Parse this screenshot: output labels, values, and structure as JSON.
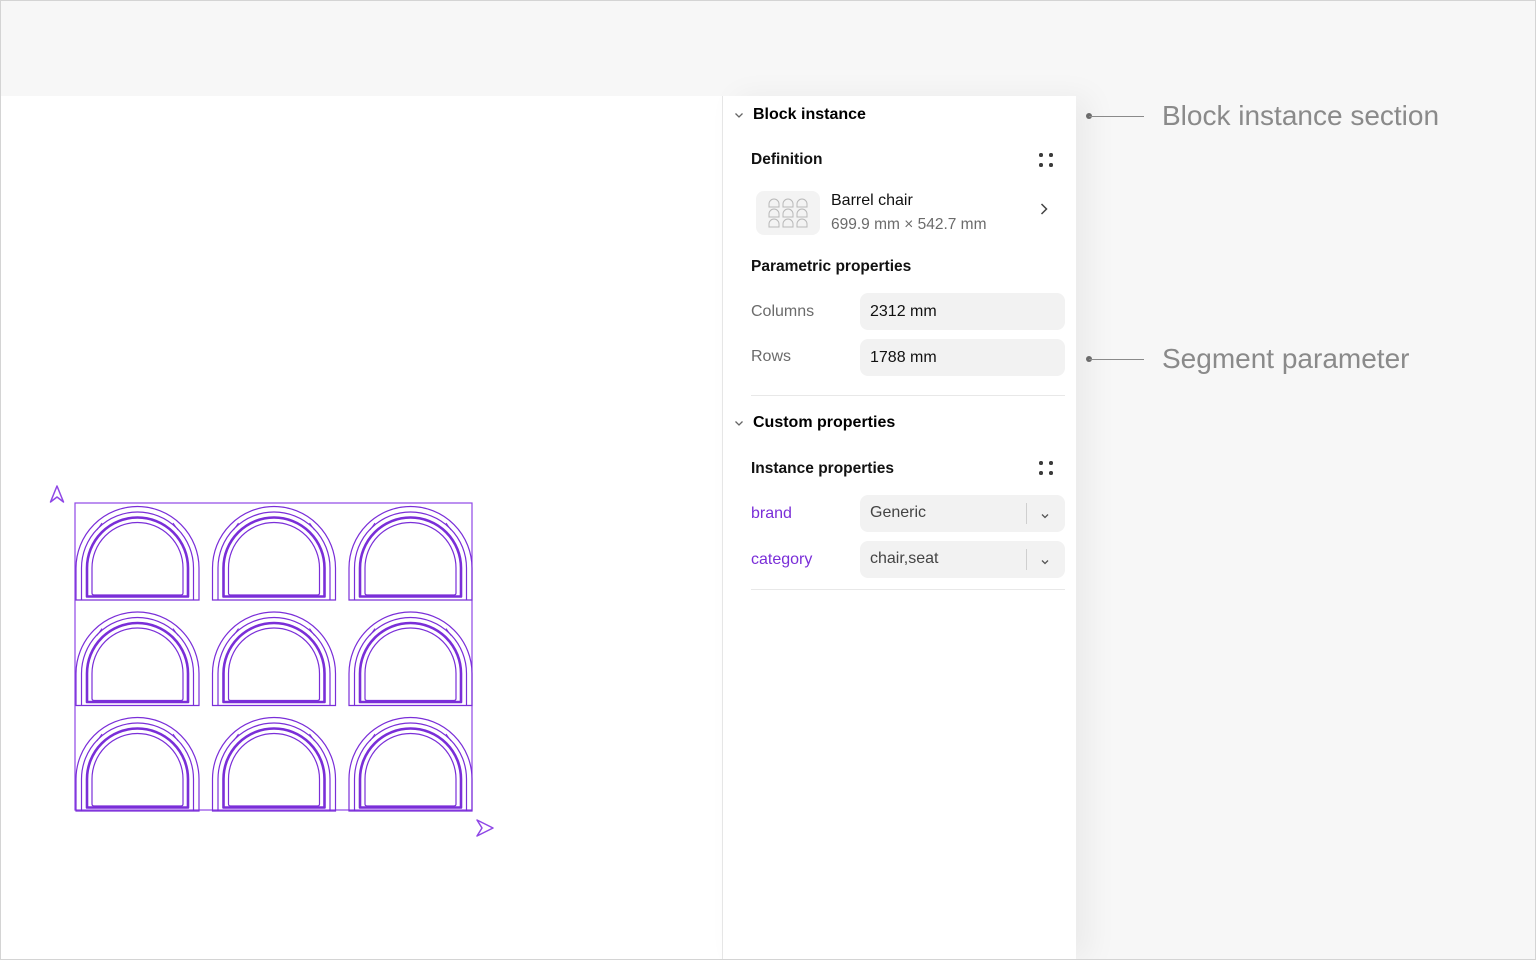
{
  "panel": {
    "block_instance": {
      "title": "Block instance",
      "definition_label": "Definition",
      "definition": {
        "name": "Barrel chair",
        "size": "699.9 mm × 542.7 mm"
      },
      "parametric_label": "Parametric properties",
      "params": [
        {
          "label": "Columns",
          "value": "2312 mm"
        },
        {
          "label": "Rows",
          "value": "1788 mm"
        }
      ]
    },
    "custom_properties": {
      "title": "Custom properties",
      "instance_label": "Instance properties",
      "props": [
        {
          "label": "brand",
          "value": "Generic"
        },
        {
          "label": "category",
          "value": "chair,seat"
        }
      ]
    }
  },
  "annotations": {
    "block_instance_section": "Block instance section",
    "segment_parameter": "Segment parameter"
  },
  "canvas": {
    "grid_columns": 3,
    "grid_rows": 3,
    "accent_color": "#7a2ed8",
    "handle_icons": [
      "start-arrow-icon",
      "end-arrow-icon"
    ]
  }
}
